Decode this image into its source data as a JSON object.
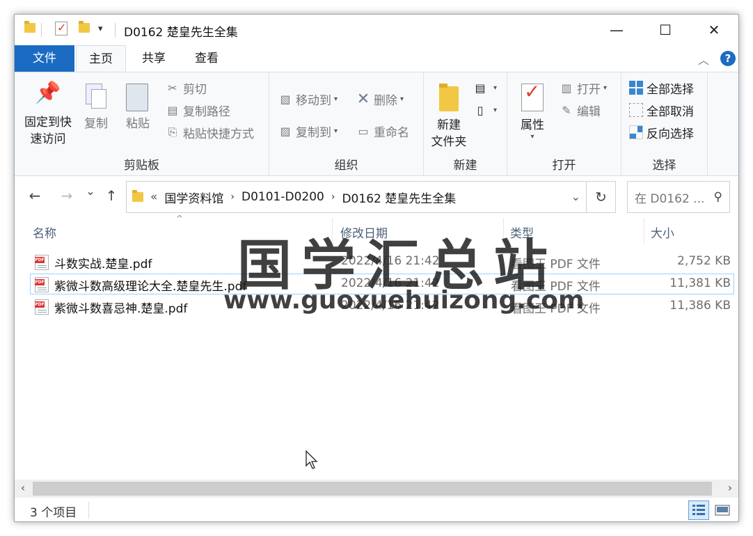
{
  "window": {
    "title": "D0162 楚皇先生全集",
    "minimize_glyph": "—",
    "maximize_glyph": "☐",
    "close_glyph": "✕",
    "qa_dropdown_glyph": "▾"
  },
  "tabs": {
    "file": "文件",
    "home": "主页",
    "share": "共享",
    "view": "查看",
    "collapse_glyph": "︿",
    "help_glyph": "?"
  },
  "ribbon": {
    "clipboard": {
      "label": "剪贴板",
      "pin_line1": "固定到快",
      "pin_line2": "速访问",
      "copy": "复制",
      "paste": "粘贴",
      "cut": "剪切",
      "copy_path": "复制路径",
      "paste_shortcut": "粘贴快捷方式"
    },
    "organize": {
      "label": "组织",
      "move_to": "移动到",
      "copy_to": "复制到",
      "delete": "删除",
      "rename": "重命名"
    },
    "new": {
      "label": "新建",
      "new_folder_line1": "新建",
      "new_folder_line2": "文件夹"
    },
    "open": {
      "label": "打开",
      "properties": "属性",
      "open": "打开",
      "edit": "编辑"
    },
    "select": {
      "label": "选择",
      "select_all": "全部选择",
      "select_none": "全部取消",
      "invert": "反向选择"
    }
  },
  "nav": {
    "back_glyph": "←",
    "forward_glyph": "→",
    "recent_glyph": "⌄",
    "up_glyph": "↑",
    "overflow": "«",
    "path": [
      "国学资料馆",
      "D0101-D0200",
      "D0162 楚皇先生全集"
    ],
    "path_sep": "›",
    "dropdown_glyph": "⌄",
    "refresh_glyph": "↻",
    "search_placeholder": "在 D0162 ...",
    "search_glyph": "⚲"
  },
  "columns": {
    "name": "名称",
    "date": "修改日期",
    "type": "类型",
    "size": "大小",
    "sort_glyph": "^"
  },
  "files": [
    {
      "name": "斗数实战.楚皇.pdf",
      "date": "2022/4/16 21:42",
      "type": "看图王 PDF 文件",
      "size": "2,752 KB"
    },
    {
      "name": "紫微斗数高级理论大全.楚皇先生.pdf",
      "date": "2022/4/16 21:42",
      "type": "看图王 PDF 文件",
      "size": "11,381 KB"
    },
    {
      "name": "紫微斗数喜忌神.楚皇.pdf",
      "date": "2022/4/16 21:42",
      "type": "看图王 PDF 文件",
      "size": "11,386 KB"
    }
  ],
  "file_icon_label": "PDF",
  "watermark": {
    "cn": "国学汇总站",
    "url": "www.guoxuehuizong.com"
  },
  "scroll": {
    "left_glyph": "‹",
    "right_glyph": "›"
  },
  "status": {
    "count": "3 个项目"
  },
  "colors": {
    "accent": "#1b6bc2",
    "selection_border": "#99d1ff",
    "folder": "#f2c744"
  }
}
